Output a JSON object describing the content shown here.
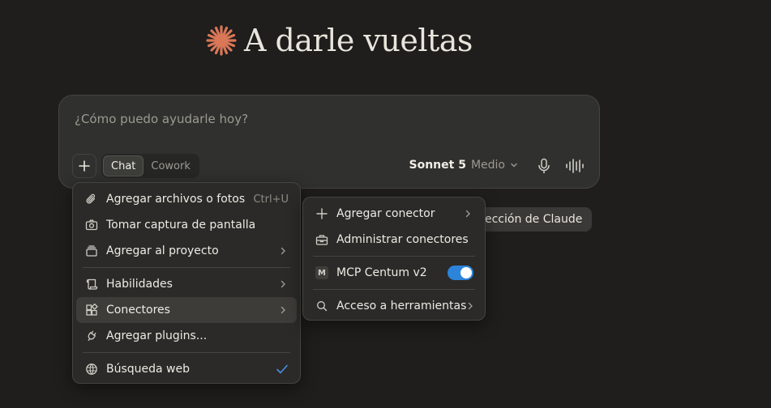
{
  "heading": {
    "text": "A darle vueltas",
    "accent_color": "#d97757"
  },
  "composer": {
    "placeholder": "¿Cómo puedo ayudarle hoy?",
    "modes": [
      {
        "label": "Chat",
        "active": true
      },
      {
        "label": "Cowork",
        "active": false
      }
    ],
    "model_name": "Sonnet 5",
    "model_level": "Medio"
  },
  "suggestion_pill": {
    "label": "ección de Claude"
  },
  "main_menu": {
    "items": [
      {
        "label": "Agregar archivos o fotos",
        "shortcut": "Ctrl+U",
        "icon": "paperclip-icon"
      },
      {
        "label": "Tomar captura de pantalla",
        "icon": "camera-icon"
      },
      {
        "label": "Agregar al proyecto",
        "icon": "project-box-icon",
        "submenu": true
      },
      {
        "label": "Habilidades",
        "icon": "scroll-icon",
        "submenu": true
      },
      {
        "label": "Conectores",
        "icon": "blocks-icon",
        "submenu": true,
        "highlighted": true
      },
      {
        "label": "Agregar plugins...",
        "icon": "plug-icon"
      },
      {
        "label": "Búsqueda web",
        "icon": "globe-icon",
        "checked": true
      }
    ]
  },
  "connectors_menu": {
    "items": [
      {
        "label": "Agregar conector",
        "icon": "plus-icon",
        "submenu": true
      },
      {
        "label": "Administrar conectores",
        "icon": "toolbox-icon"
      },
      {
        "label": "MCP Centum v2",
        "badge": "M",
        "toggle_on": true
      },
      {
        "label": "Acceso a herramientas",
        "icon": "search-icon",
        "submenu": true
      }
    ]
  },
  "colors": {
    "background": "#1f1e1d",
    "toggle": "#2c84db",
    "check": "#4a90e2"
  }
}
